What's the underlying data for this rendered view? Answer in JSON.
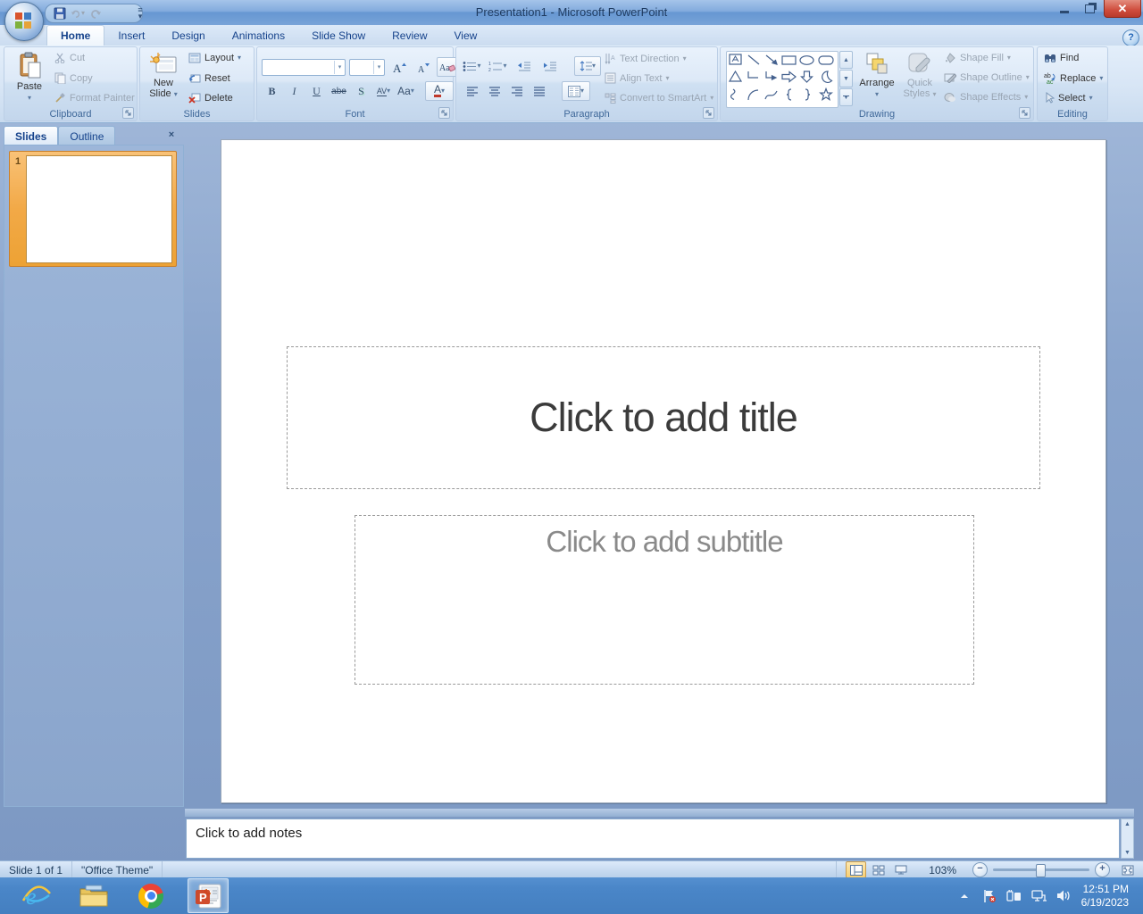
{
  "window": {
    "title": "Presentation1 - Microsoft PowerPoint"
  },
  "tabs": {
    "items": [
      {
        "label": "Home"
      },
      {
        "label": "Insert"
      },
      {
        "label": "Design"
      },
      {
        "label": "Animations"
      },
      {
        "label": "Slide Show"
      },
      {
        "label": "Review"
      },
      {
        "label": "View"
      }
    ]
  },
  "ribbon": {
    "clipboard": {
      "group_label": "Clipboard",
      "paste": "Paste",
      "cut": "Cut",
      "copy": "Copy",
      "format_painter": "Format Painter"
    },
    "slides": {
      "group_label": "Slides",
      "new_slide": "New Slide",
      "layout": "Layout",
      "reset": "Reset",
      "delete": "Delete"
    },
    "font": {
      "group_label": "Font",
      "bold": "B",
      "italic": "I",
      "underline": "U",
      "strikethrough": "abe",
      "shadow": "S",
      "char_spacing": "AV",
      "change_case": "Aa",
      "font_color": "A"
    },
    "paragraph": {
      "group_label": "Paragraph",
      "text_direction": "Text Direction",
      "align_text": "Align Text",
      "convert_to_smartart": "Convert to SmartArt"
    },
    "drawing": {
      "group_label": "Drawing",
      "arrange": "Arrange",
      "quick_styles": "Quick Styles",
      "shape_fill": "Shape Fill",
      "shape_outline": "Shape Outline",
      "shape_effects": "Shape Effects"
    },
    "editing": {
      "group_label": "Editing",
      "find": "Find",
      "replace": "Replace",
      "select": "Select"
    }
  },
  "slides_panel": {
    "slides_tab": "Slides",
    "outline_tab": "Outline",
    "slide_number": "1"
  },
  "slide": {
    "title_placeholder": "Click to add title",
    "subtitle_placeholder": "Click to add subtitle"
  },
  "notes": {
    "placeholder": "Click to add notes"
  },
  "status": {
    "slide_indicator": "Slide 1 of 1",
    "theme_name": "\"Office Theme\"",
    "zoom": "103%"
  },
  "tray": {
    "time": "12:51 PM",
    "date": "6/19/2023"
  }
}
